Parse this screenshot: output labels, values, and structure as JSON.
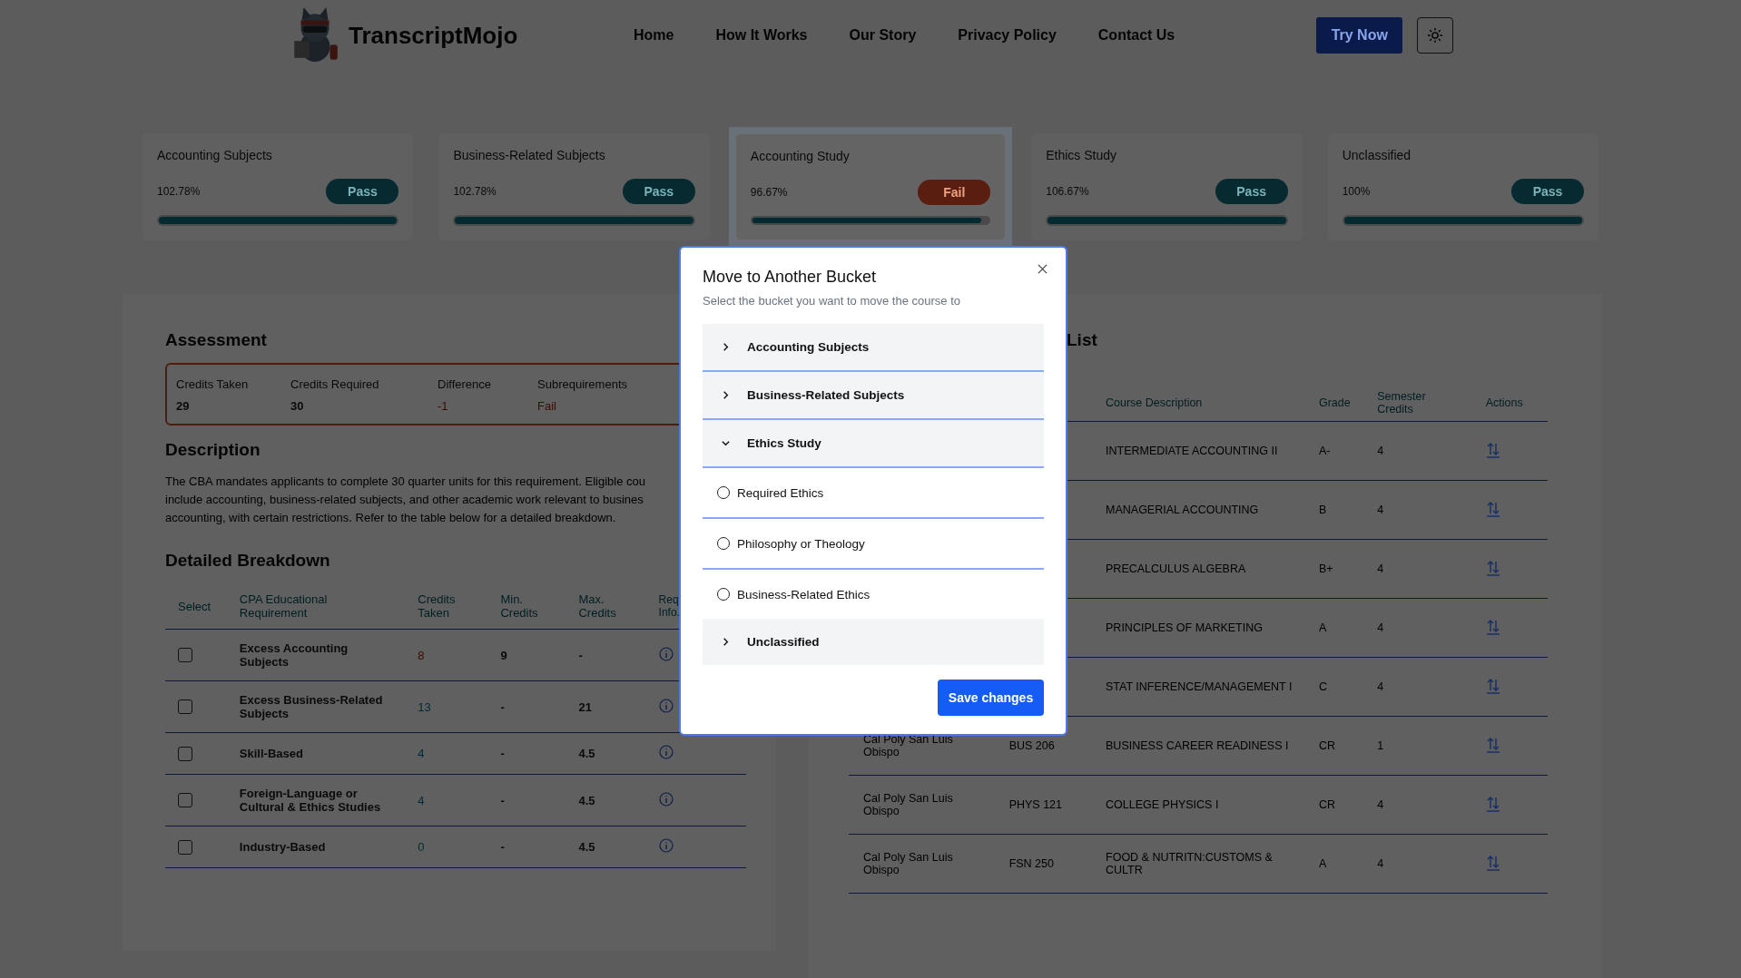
{
  "header": {
    "brand": "TranscriptMojo",
    "nav": [
      "Home",
      "How It Works",
      "Our Story",
      "Privacy Policy",
      "Contact Us"
    ],
    "cta": "Try Now"
  },
  "buckets": [
    {
      "title": "Accounting Subjects",
      "percent": "102.78%",
      "status": "Pass",
      "passed": true,
      "level": 1,
      "selected": false
    },
    {
      "title": "Business-Related Subjects",
      "percent": "102.78%",
      "status": "Pass",
      "passed": true,
      "level": 1,
      "selected": false
    },
    {
      "title": "Accounting Study",
      "percent": "96.67%",
      "status": "Fail",
      "passed": false,
      "level": 0.97,
      "selected": true
    },
    {
      "title": "Ethics Study",
      "percent": "106.67%",
      "status": "Pass",
      "passed": true,
      "level": 1,
      "selected": false
    },
    {
      "title": "Unclassified",
      "percent": "100%",
      "status": "Pass",
      "passed": true,
      "level": 1,
      "selected": false
    }
  ],
  "assessment": {
    "title": "Assessment",
    "stats": [
      {
        "label": "Credits Taken",
        "value": "29",
        "alert": false
      },
      {
        "label": "Credits Required",
        "value": "30",
        "alert": false
      },
      {
        "label": "Difference",
        "value": "-1",
        "alert": true
      },
      {
        "label": "Subrequirements",
        "value": "Fail",
        "alert": true
      }
    ]
  },
  "description": {
    "title": "Description",
    "lines": [
      "The CBA mandates applicants to complete 30 quarter units for this requirement. Eligible cou",
      "include accounting, business-related subjects, and other academic work relevant to busines",
      "accounting, with certain restrictions. Refer to the table below for a detailed breakdown."
    ]
  },
  "breakdown": {
    "title": "Detailed Breakdown",
    "columns": [
      "Select",
      "CPA Educational Requirement",
      "Credits Taken",
      "Min. Credits",
      "Max. Credits",
      "Req Info."
    ],
    "rows": [
      {
        "checked": false,
        "requirement": "Excess Accounting Subjects",
        "taken": "8",
        "met": false,
        "min": "9",
        "max": "-"
      },
      {
        "checked": false,
        "requirement": "Excess Business-Related Subjects",
        "taken": "13",
        "met": true,
        "min": "-",
        "max": "21"
      },
      {
        "checked": false,
        "requirement": "Skill-Based",
        "taken": "4",
        "met": true,
        "min": "-",
        "max": "4.5"
      },
      {
        "checked": false,
        "requirement": "Foreign-Language or Cultural & Ethics Studies",
        "taken": "4",
        "met": true,
        "min": "-",
        "max": "4.5"
      },
      {
        "checked": false,
        "requirement": "Industry-Based",
        "taken": "0",
        "met": true,
        "min": "-",
        "max": "4.5"
      }
    ]
  },
  "course_list": {
    "title": "List",
    "columns": [
      "Course Description",
      "Grade",
      "Semester Credits",
      "Actions"
    ],
    "rows": [
      {
        "description": "INTERMEDIATE ACCOUNTING II",
        "grade": "A-",
        "credits": "4"
      },
      {
        "description": "MANAGERIAL ACCOUNTING",
        "grade": "B",
        "credits": "4"
      },
      {
        "description": "PRECALCULUS ALGEBRA",
        "grade": "B+",
        "credits": "4"
      },
      {
        "description": "PRINCIPLES OF MARKETING",
        "grade": "A",
        "credits": "4"
      },
      {
        "description": "STAT INFERENCE/MANAGEMENT I",
        "grade": "C",
        "credits": "4"
      },
      {
        "institution": "Cal Poly San Luis Obispo",
        "code": "BUS 206",
        "description": "BUSINESS CAREER READINESS I",
        "grade": "CR",
        "credits": "1"
      },
      {
        "institution": "Cal Poly San Luis Obispo",
        "code": "PHYS 121",
        "description": "COLLEGE PHYSICS I",
        "grade": "CR",
        "credits": "4"
      },
      {
        "institution": "Cal Poly San Luis Obispo",
        "code": "FSN 250",
        "description": "FOOD & NUTRITN:CUSTOMS & CULTR",
        "grade": "A",
        "credits": "4"
      }
    ]
  },
  "modal": {
    "title": "Move to Another Bucket",
    "subtitle": "Select the bucket you want to move the course to",
    "buckets": [
      {
        "label": "Accounting Subjects",
        "expanded": false
      },
      {
        "label": "Business-Related Subjects",
        "expanded": false
      },
      {
        "label": "Ethics Study",
        "expanded": true,
        "children": [
          {
            "label": "Required Ethics",
            "selected": false
          },
          {
            "label": "Philosophy or Theology",
            "selected": false
          },
          {
            "label": "Business-Related Ethics",
            "selected": false
          }
        ]
      },
      {
        "label": "Unclassified",
        "expanded": false
      }
    ],
    "save": "Save changes"
  }
}
